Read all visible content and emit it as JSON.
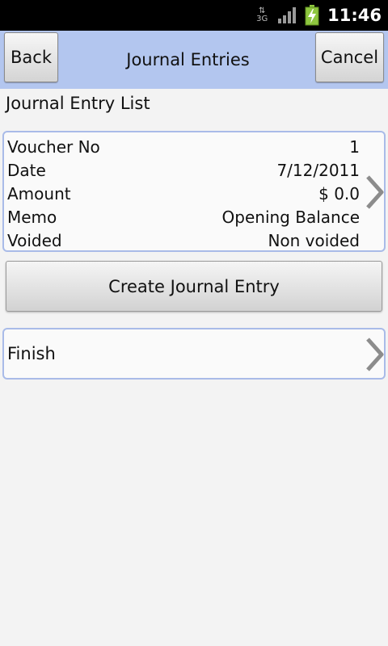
{
  "status_bar": {
    "network": "3G",
    "time": "11:46",
    "icons": [
      "network-3g-icon",
      "signal-icon",
      "battery-charging-icon"
    ]
  },
  "header": {
    "back_label": "Back",
    "title": "Journal Entries",
    "cancel_label": "Cancel"
  },
  "section_label": "Journal Entry List",
  "entries": [
    {
      "rows": [
        {
          "label": "Voucher No",
          "value": "1"
        },
        {
          "label": "Date",
          "value": "7/12/2011"
        },
        {
          "label": "Amount",
          "value": "$ 0.0"
        },
        {
          "label": "Memo",
          "value": "Opening Balance"
        },
        {
          "label": "Voided",
          "value": "Non voided"
        }
      ]
    }
  ],
  "create_button_label": "Create Journal Entry",
  "finish_label": "Finish",
  "colors": {
    "titlebar": "#b3c6ef",
    "card_border": "#a9bbe8",
    "battery": "#8ec63f"
  }
}
